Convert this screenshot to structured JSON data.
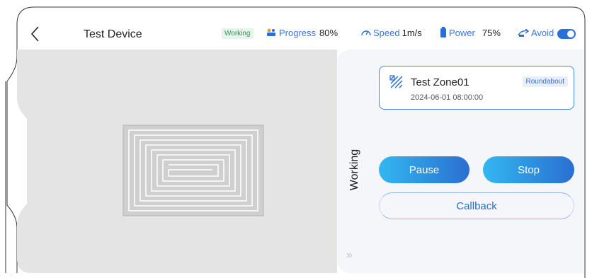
{
  "header": {
    "title": "Test Device",
    "status_badge": "Working",
    "progress_label": "Progress",
    "progress_value": "80%",
    "speed_label": "Speed",
    "speed_value": "1m/s",
    "power_label": "Power",
    "power_value": "75%",
    "avoid_label": "Avoid",
    "avoid_enabled": true
  },
  "panel": {
    "status_text": "Working",
    "zone": {
      "name": "Test Zone01",
      "date": "2024-06-01 08:00:00",
      "tag": "Roundabout"
    },
    "buttons": {
      "pause": "Pause",
      "stop": "Stop",
      "callback": "Callback"
    }
  },
  "icons": [
    "back-arrow-icon",
    "mower-progress-icon",
    "speedometer-icon",
    "battery-icon",
    "avoid-icon",
    "zone-pattern-icon",
    "double-chevron-right-icon"
  ],
  "colors": {
    "accent": "#2a6fd1",
    "accent_light": "#33b7f0",
    "working_green": "#3a8f5a",
    "map_background": "#e4e4e4",
    "panel_background": "#f4f6f9"
  }
}
